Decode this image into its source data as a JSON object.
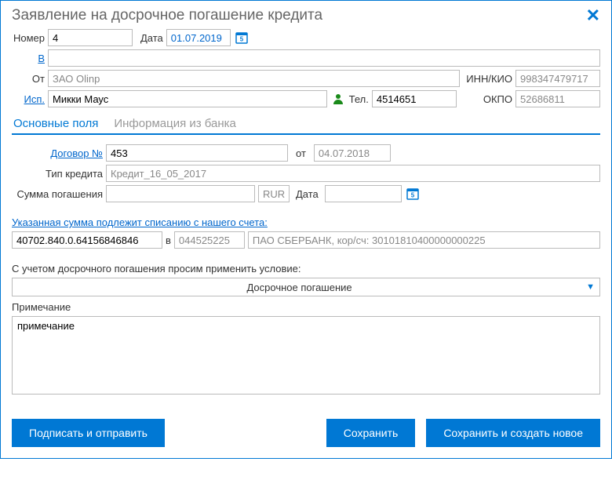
{
  "dialog": {
    "title": "Заявление на досрочное погашение кредита"
  },
  "header": {
    "number_label": "Номер",
    "number_value": "4",
    "date_label": "Дата",
    "date_value": "01.07.2019",
    "to_label": "В",
    "to_value": "",
    "from_label": "От",
    "from_value": "ЗАО Olinp",
    "inn_label": "ИНН/КИО",
    "inn_value": "998347479717",
    "exec_label": "Исп.",
    "exec_value": "Микки Маус",
    "tel_label": "Тел.",
    "tel_value": "4514651",
    "okpo_label": "ОКПО",
    "okpo_value": "52686811"
  },
  "tabs": {
    "main": "Основные поля",
    "bank_info": "Информация из банка"
  },
  "agreement": {
    "number_label": "Договор №",
    "number_value": "453",
    "from_label": "от",
    "from_value": "04.07.2018",
    "credit_type_label": "Тип кредита",
    "credit_type_value": "Кредит_16_05_2017",
    "repay_sum_label": "Сумма погашения",
    "repay_sum_value": "",
    "currency": "RUR",
    "repay_date_label": "Дата",
    "repay_date_value": ""
  },
  "account": {
    "link_text": "Указанная сумма подлежит списанию с нашего счета:",
    "account_value": "40702.840.0.64156846846",
    "in_label": "в",
    "bik_value": "044525225",
    "bank_value": "ПАО СБЕРБАНК, кор/сч: 30101810400000000225"
  },
  "condition": {
    "label": "С учетом досрочного погашения просим применить условие:",
    "value": "Досрочное погашение"
  },
  "note": {
    "label": "Примечание",
    "value": "примечание"
  },
  "buttons": {
    "sign_send": "Подписать и отправить",
    "save": "Сохранить",
    "save_new": "Сохранить и создать новое"
  }
}
